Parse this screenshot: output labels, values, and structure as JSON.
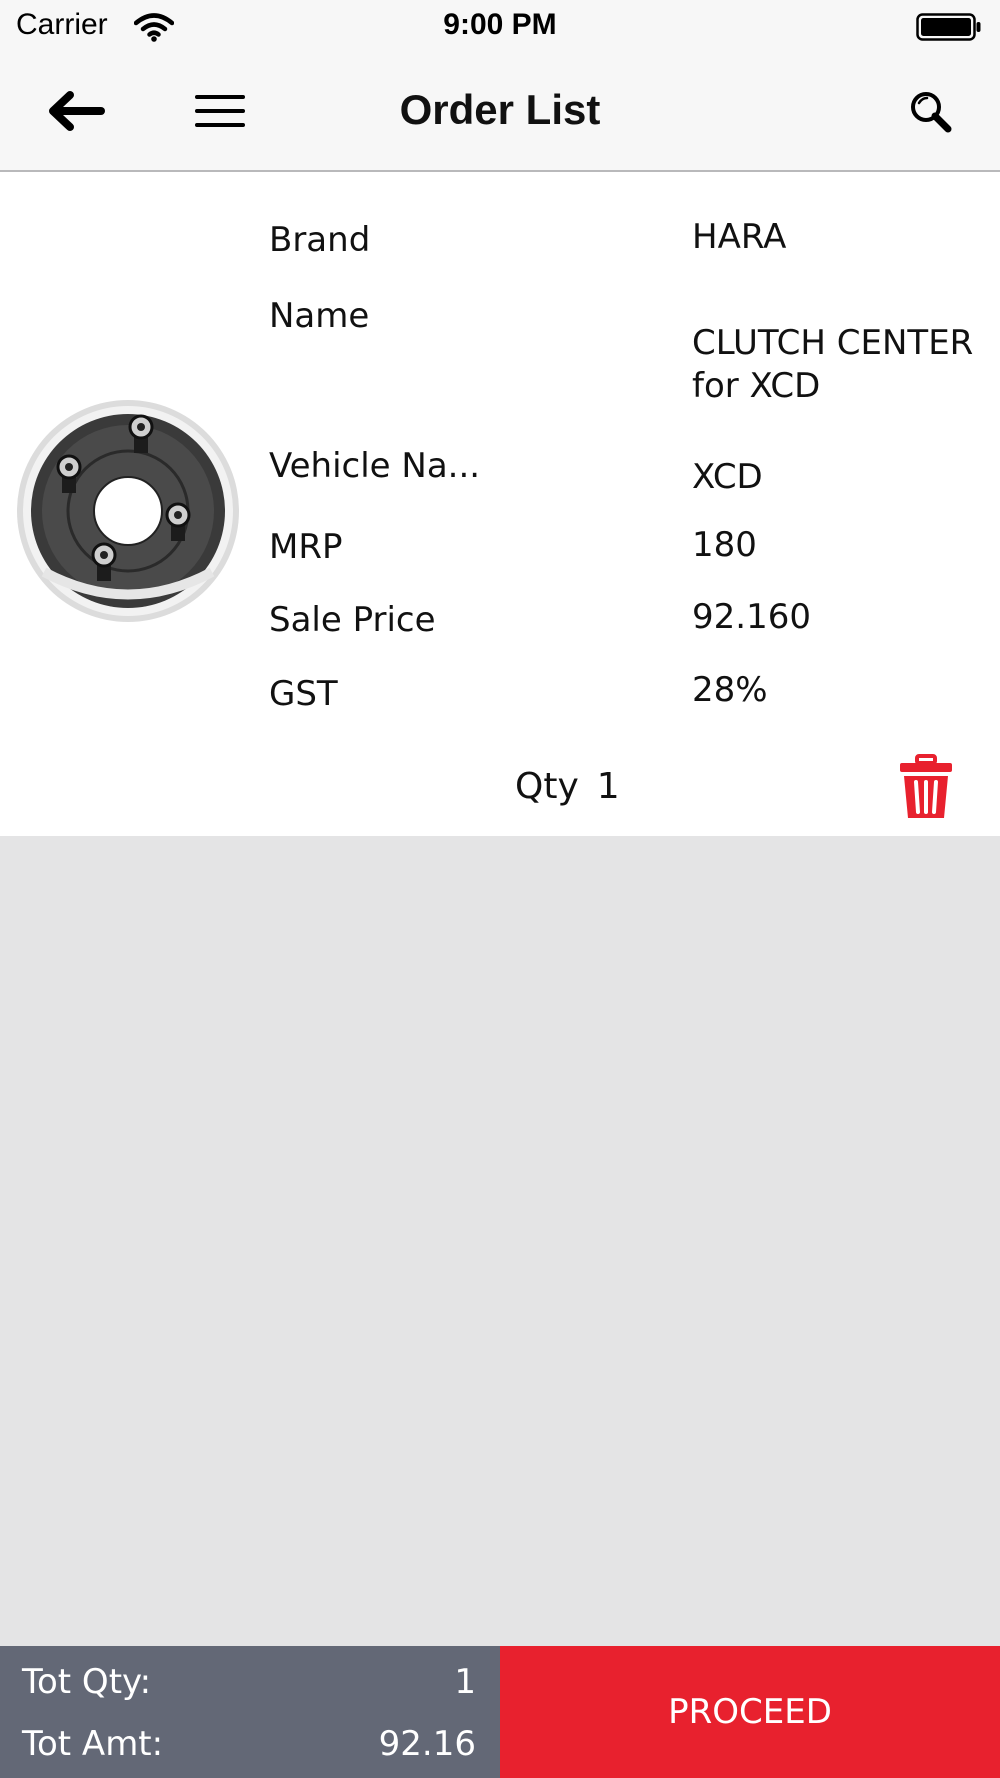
{
  "status_bar": {
    "carrier": "Carrier",
    "time": "9:00 PM",
    "icons": [
      "wifi-icon",
      "battery-icon"
    ]
  },
  "nav": {
    "title": "Order List",
    "icons": [
      "back-arrow-icon",
      "hamburger-menu-icon",
      "search-icon"
    ]
  },
  "order_item": {
    "image": "clutch-center-part-image",
    "fields": [
      {
        "label": "Brand",
        "value": "HARA"
      },
      {
        "label": "Name",
        "value": "CLUTCH CENTER for XCD"
      },
      {
        "label": "Vehicle Na...",
        "value": "XCD"
      },
      {
        "label": "MRP",
        "value": "180"
      },
      {
        "label": "Sale Price",
        "value": "92.160"
      },
      {
        "label": "GST",
        "value": "28%"
      }
    ],
    "qty_label": "Qty",
    "qty_value": "1",
    "delete_icon": "trash-icon"
  },
  "footer": {
    "tot_qty_label": "Tot Qty:",
    "tot_qty_value": "1",
    "tot_amt_label": "Tot Amt:",
    "tot_amt_value": "92.16",
    "proceed_label": "PROCEED"
  },
  "colors": {
    "accent_red": "#e8212e",
    "footer_gray": "#636876",
    "background_gray": "#e4e4e5",
    "bar_background": "#f7f7f7"
  }
}
